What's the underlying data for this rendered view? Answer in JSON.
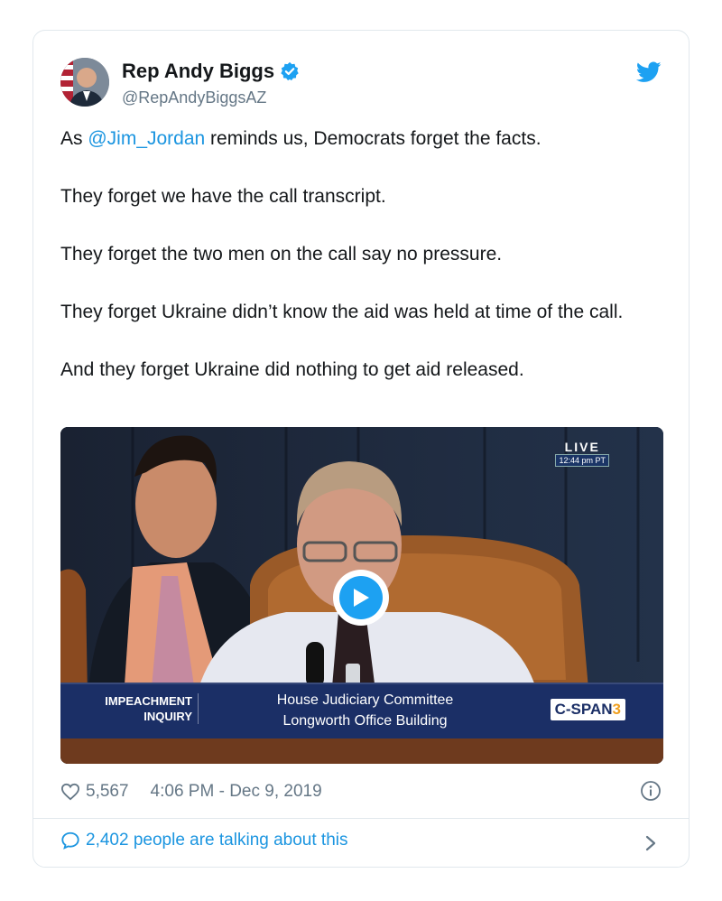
{
  "author": {
    "name": "Rep Andy Biggs",
    "handle": "@RepAndyBiggsAZ",
    "verified_icon": "verified-badge-icon",
    "brand_icon": "twitter-bird-icon",
    "brand_color": "#1da1f2"
  },
  "tweet": {
    "line1_prefix": "As ",
    "mention": "@Jim_Jordan",
    "line1_suffix": " reminds us, Democrats forget the facts.",
    "line2": "They forget we have the call transcript.",
    "line3": "They forget the two men on the call say no pressure.",
    "line4": "They forget Ukraine didn’t know the aid was held at time of the call.",
    "line5": "And they forget Ukraine did nothing to get aid released."
  },
  "video": {
    "live_label": "LIVE",
    "live_time": "12:44 pm PT",
    "chyron_left_1": "IMPEACHMENT",
    "chyron_left_2": "INQUIRY",
    "chyron_mid_1": "House Judiciary Committee",
    "chyron_mid_2": "Longworth Office Building",
    "network": "C-SPAN",
    "network_num": "3",
    "play_icon": "play-icon"
  },
  "footer": {
    "likes": "5,567",
    "time": "4:06 PM - Dec 9, 2019",
    "talking": "2,402 people are talking about this",
    "heart_icon": "heart-icon",
    "info_icon": "info-icon",
    "bubble_icon": "speech-bubble-icon",
    "chevron_icon": "chevron-right-icon"
  }
}
